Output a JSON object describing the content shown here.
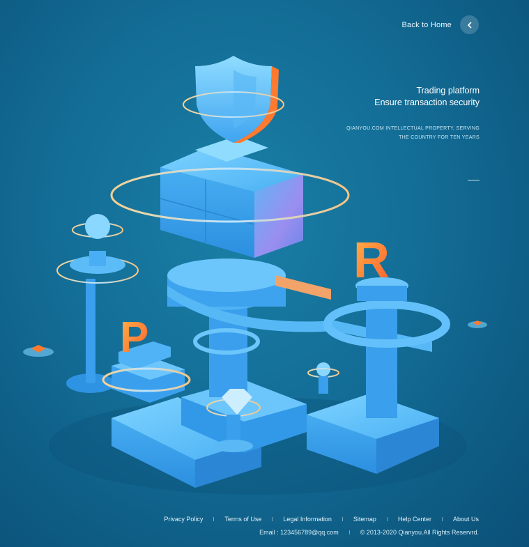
{
  "header": {
    "back_label": "Back to Home",
    "back_icon": "chevron-left-icon"
  },
  "hero": {
    "line1": "Trading platform",
    "line2": "Ensure transaction security",
    "sub1": "QIANYOU.COM INTELLECTUAL PROPERTY, SERVING",
    "sub2": "THE COUNTRY FOR TEN YEARS"
  },
  "illustration": {
    "letters": [
      "P",
      "R"
    ],
    "icon": "shield-icon"
  },
  "footer": {
    "links": [
      {
        "label": "Privacy Policy"
      },
      {
        "label": "Terms of Use"
      },
      {
        "label": "Legal Information"
      },
      {
        "label": "Sitemap"
      },
      {
        "label": "Help Center"
      },
      {
        "label": "About Us"
      }
    ],
    "email": "Email : 123456789@qq.com",
    "copyright": "© 2013-2020 Qianyou.All Rights Reservrd."
  },
  "colors": {
    "background": "#136d96",
    "block": "#3aa6ee",
    "accent": "#ff7a2f",
    "ring": "#f1c27a"
  }
}
